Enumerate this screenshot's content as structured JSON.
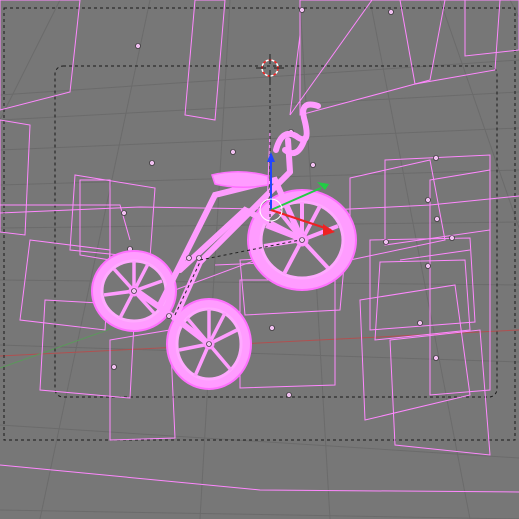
{
  "viewport": {
    "background_color": "#777777",
    "grid_color": "#6b6b6b",
    "axis_x_color": "#b05050",
    "axis_y_color": "#5a9a5a",
    "selection_color": "#ff88ff",
    "selection_fill": "#ff9cff",
    "camera_frame_color": "#1a1a1a",
    "origin_point_color": "#f0c0f0"
  },
  "gizmo": {
    "z_axis_color": "#2244ff",
    "y_axis_color": "#22cc44",
    "x_axis_color": "#ee2222"
  },
  "cursor_3d": {
    "ring_colors": [
      "#ffffff",
      "#ff2222"
    ]
  },
  "object": {
    "name_icon": "tricycle-model-icon",
    "state": "selected"
  }
}
